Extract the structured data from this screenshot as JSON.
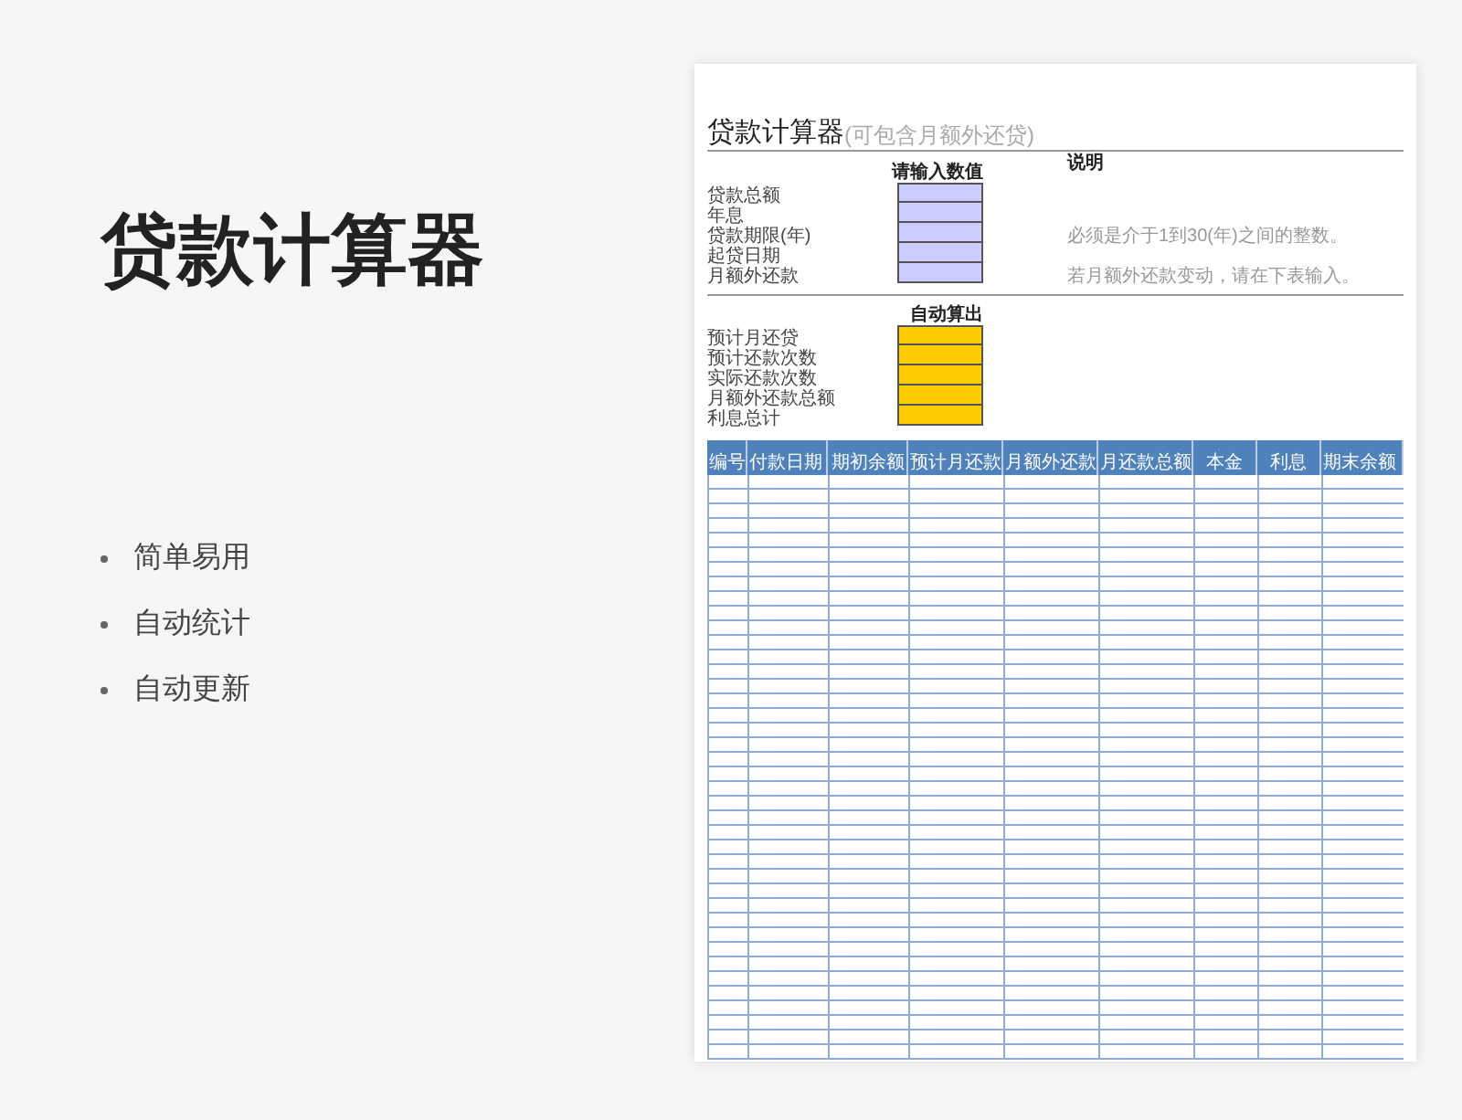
{
  "heading": "贷款计算器",
  "features": [
    "简单易用",
    "自动统计",
    "自动更新"
  ],
  "sheet": {
    "title": "贷款计算器",
    "subtitle": "(可包含月额外还贷)",
    "input_section": {
      "header": "请输入数值",
      "notes_header": "说明",
      "rows": [
        {
          "label": "贷款总额"
        },
        {
          "label": "年息"
        },
        {
          "label": "贷款期限(年)",
          "note": "必须是介于1到30(年)之间的整数。"
        },
        {
          "label": "起贷日期"
        },
        {
          "label": "月额外还款",
          "note": "若月额外还款变动，请在下表输入。"
        }
      ]
    },
    "output_section": {
      "header": "自动算出",
      "rows": [
        {
          "label": "预计月还贷"
        },
        {
          "label": "预计还款次数"
        },
        {
          "label": "实际还款次数"
        },
        {
          "label": "月额外还款总额"
        },
        {
          "label": "利息总计"
        }
      ]
    },
    "table": {
      "columns": [
        "编号",
        "付款日期",
        "期初余额",
        "预计月还款",
        "月额外还款",
        "月还款总额",
        "本金",
        "利息",
        "期末余额"
      ]
    }
  }
}
